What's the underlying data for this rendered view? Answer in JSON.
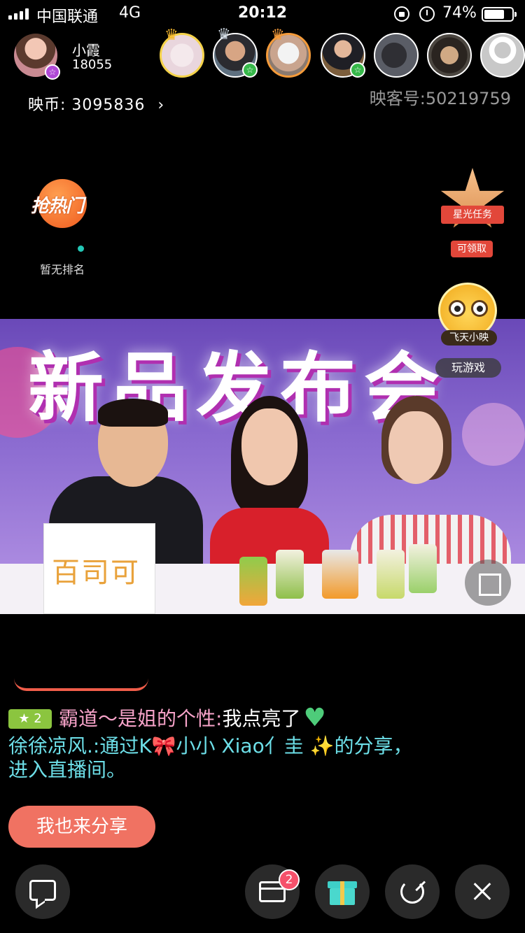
{
  "status_bar": {
    "carrier": "中国联通",
    "network": "4G",
    "time": "20:12",
    "battery_percent": "74%",
    "battery_level": 0.74
  },
  "host": {
    "name": "小霞",
    "fans": "18055",
    "coins_label": "映币:",
    "coins_value": "3095836",
    "coins_arrow": "›",
    "account_id": "映客号:50219759"
  },
  "viewers": [
    {
      "name": "viewer-1",
      "crown": "gold"
    },
    {
      "name": "viewer-2",
      "crown": "silver",
      "badge": true
    },
    {
      "name": "viewer-3",
      "crown": "gold"
    },
    {
      "name": "viewer-4",
      "badge": true
    },
    {
      "name": "viewer-5"
    },
    {
      "name": "viewer-6"
    },
    {
      "name": "viewer-7"
    }
  ],
  "hot_rank": {
    "logo_text": "抢热门",
    "status": "暂无排名"
  },
  "star_task": {
    "label": "星光任务",
    "claim": "可领取"
  },
  "game": {
    "owl_label": "飞天小映",
    "play_button": "玩游戏"
  },
  "video": {
    "banner_title": "新品发布会",
    "brand_logo": "百司可"
  },
  "chat": {
    "level": "2",
    "line1_user": "霸道～是姐的个性:",
    "line1_message": "我点亮了",
    "line2": "徐徐凉风.:通过K🎀小小 Xiao亻圭 ✨的分享，进入直播间。",
    "share_button": "我也来分享"
  },
  "bottom_bar": {
    "mail_badge": "2"
  },
  "colors": {
    "accent": "#f07262",
    "level_badge": "#8bc53f",
    "user_pink": "#f7a3c9",
    "system_cyan": "#6ddfe8",
    "heart_green": "#4ecc7a"
  }
}
